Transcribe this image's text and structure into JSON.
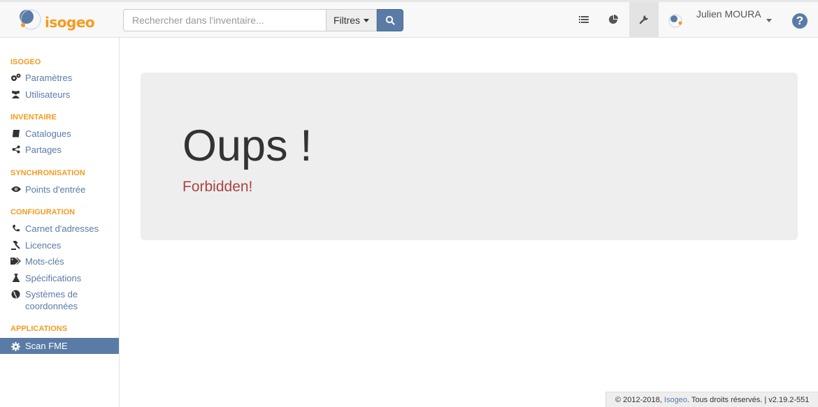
{
  "brand": {
    "name": "isogeo",
    "color": "#f59b1e"
  },
  "search": {
    "placeholder": "Rechercher dans l'inventaire...",
    "filter_label": "Filtres"
  },
  "nav": {
    "icons": [
      "list-icon",
      "pie-chart-icon",
      "wrench-icon"
    ],
    "user_name": "Julien MOURA",
    "help_label": "?"
  },
  "sidebar": {
    "sections": [
      {
        "title": "ISOGEO",
        "items": [
          {
            "label": "Paramètres",
            "icon": "gears-icon"
          },
          {
            "label": "Utilisateurs",
            "icon": "users-icon"
          }
        ]
      },
      {
        "title": "INVENTAIRE",
        "items": [
          {
            "label": "Catalogues",
            "icon": "book-icon"
          },
          {
            "label": "Partages",
            "icon": "share-icon"
          }
        ]
      },
      {
        "title": "SYNCHRONISATION",
        "items": [
          {
            "label": "Points d'entrée",
            "icon": "eye-icon"
          }
        ]
      },
      {
        "title": "CONFIGURATION",
        "items": [
          {
            "label": "Carnet d'adresses",
            "icon": "phone-icon"
          },
          {
            "label": "Licences",
            "icon": "gavel-icon"
          },
          {
            "label": "Mots-clés",
            "icon": "tags-icon"
          },
          {
            "label": "Spécifications",
            "icon": "flask-icon"
          },
          {
            "label": "Systèmes de coordonnées",
            "icon": "globe-icon"
          }
        ]
      },
      {
        "title": "APPLICATIONS",
        "items": [
          {
            "label": "Scan FME",
            "icon": "gear-icon",
            "active": true
          }
        ]
      }
    ]
  },
  "main": {
    "title": "Oups !",
    "message": "Forbidden!"
  },
  "footer": {
    "copyright": "© 2012-2018,",
    "brand_link": "Isogeo",
    "rights": ". Tous droits réservés. | v2.19.2-551"
  },
  "colors": {
    "accent": "#5a7ba6",
    "error": "#a94442",
    "section": "#f59b1e"
  }
}
